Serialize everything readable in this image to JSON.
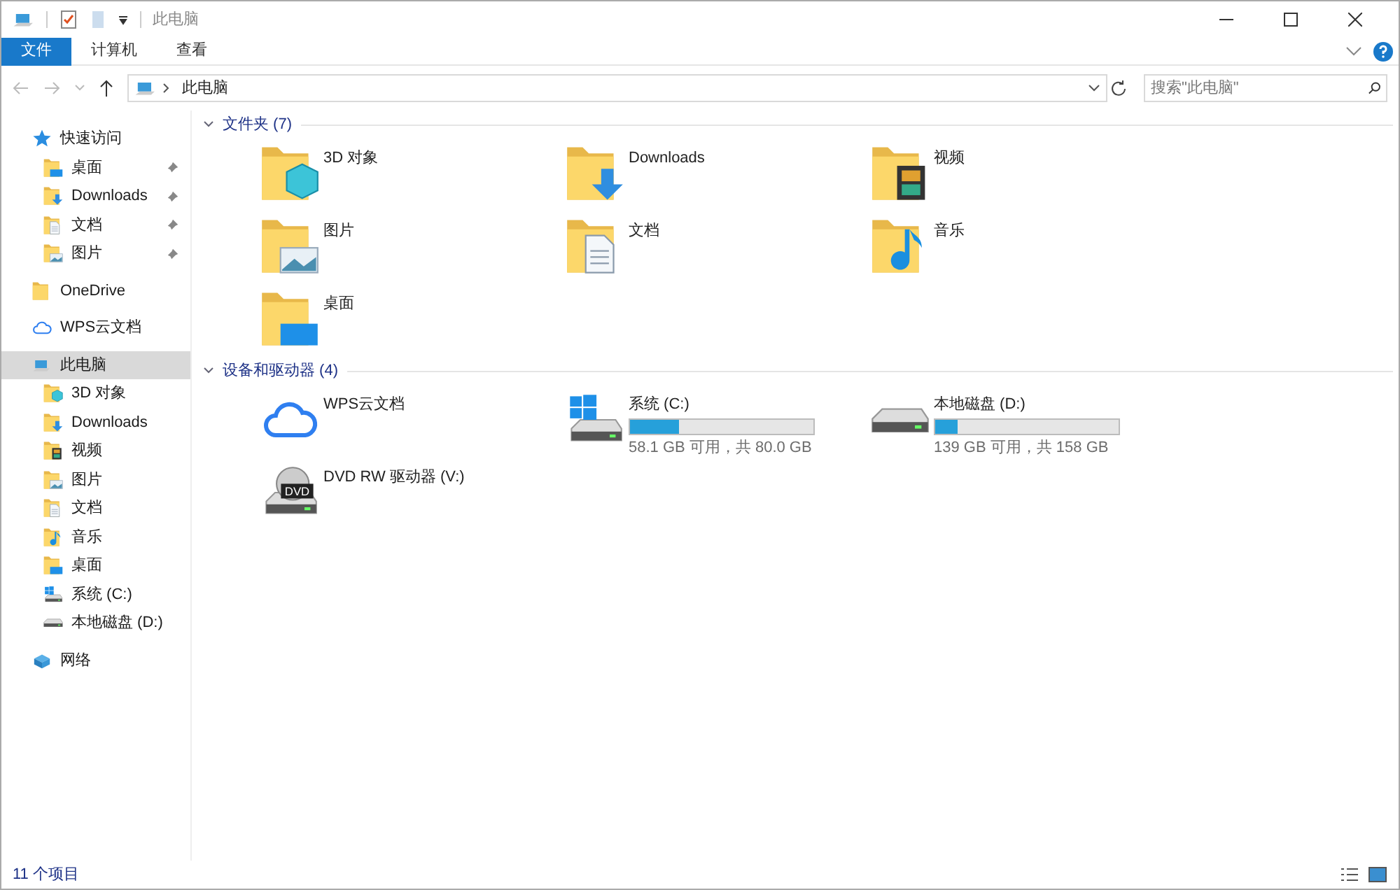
{
  "window": {
    "title": "此电脑"
  },
  "ribbon_tabs": [
    {
      "label": "文件",
      "selected": true
    },
    {
      "label": "计算机",
      "selected": false
    },
    {
      "label": "查看",
      "selected": false
    }
  ],
  "address": {
    "path": "此电脑"
  },
  "search": {
    "placeholder": "搜索\"此电脑\""
  },
  "sidebar": {
    "items": [
      {
        "label": "快速访问",
        "kind": "star",
        "selected": false,
        "children": [
          {
            "label": "桌面",
            "kind": "desktop",
            "pinned": true
          },
          {
            "label": "Downloads",
            "kind": "downloads",
            "pinned": true
          },
          {
            "label": "文档",
            "kind": "documents",
            "pinned": true
          },
          {
            "label": "图片",
            "kind": "pictures",
            "pinned": true
          }
        ]
      },
      {
        "label": "OneDrive",
        "kind": "folder",
        "selected": false
      },
      {
        "label": "WPS云文档",
        "kind": "cloud",
        "selected": false
      },
      {
        "label": "此电脑",
        "kind": "pc",
        "selected": true,
        "children": [
          {
            "label": "3D 对象",
            "kind": "objects",
            "pinned": false
          },
          {
            "label": "Downloads",
            "kind": "downloads",
            "pinned": false
          },
          {
            "label": "视频",
            "kind": "video",
            "pinned": false
          },
          {
            "label": "图片",
            "kind": "pictures",
            "pinned": false
          },
          {
            "label": "文档",
            "kind": "documents",
            "pinned": false
          },
          {
            "label": "音乐",
            "kind": "music",
            "pinned": false
          },
          {
            "label": "桌面",
            "kind": "desktop",
            "pinned": false
          },
          {
            "label": "系统 (C:)",
            "kind": "system",
            "pinned": false
          },
          {
            "label": "本地磁盘 (D:)",
            "kind": "drive",
            "pinned": false
          }
        ]
      },
      {
        "label": "网络",
        "kind": "network",
        "selected": false
      }
    ]
  },
  "groups": [
    {
      "title": "文件夹 (7)",
      "expanded": true,
      "items": [
        {
          "name": "3D 对象",
          "kind": "objects"
        },
        {
          "name": "Downloads",
          "kind": "downloads"
        },
        {
          "name": "视频",
          "kind": "video"
        },
        {
          "name": "图片",
          "kind": "pictures"
        },
        {
          "name": "文档",
          "kind": "documents"
        },
        {
          "name": "音乐",
          "kind": "music"
        },
        {
          "name": "桌面",
          "kind": "desktop"
        }
      ]
    },
    {
      "title": "设备和驱动器 (4)",
      "expanded": true,
      "items": [
        {
          "name": "WPS云文档",
          "kind": "cloud"
        },
        {
          "name": "系统 (C:)",
          "kind": "system",
          "level": 0.27,
          "space": "58.1 GB 可用，共 80.0 GB"
        },
        {
          "name": "本地磁盘 (D:)",
          "kind": "drive",
          "level": 0.12,
          "space": "139 GB 可用，共 158 GB"
        },
        {
          "name": "DVD RW 驱动器 (V:)",
          "kind": "dvd",
          "dvd_label": "DVD"
        }
      ]
    }
  ],
  "status_bar": {
    "count": "11 个项目"
  }
}
